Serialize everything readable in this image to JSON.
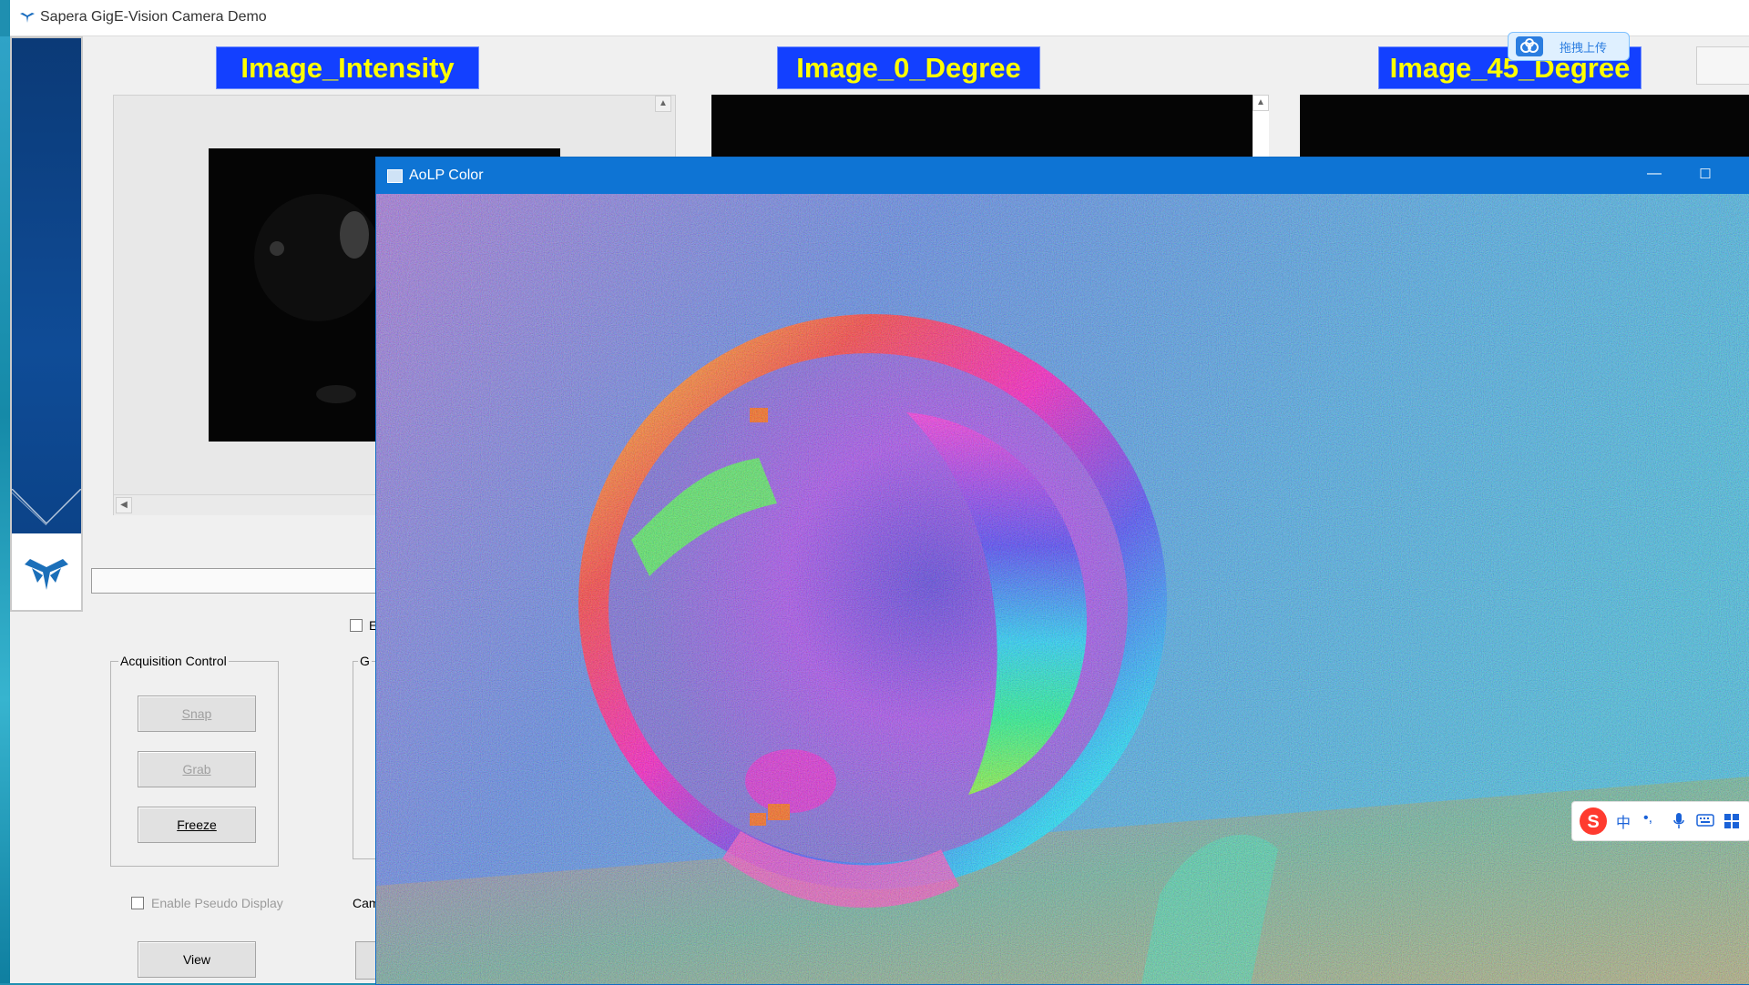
{
  "app": {
    "title": "Sapera GigE-Vision Camera Demo"
  },
  "image_labels": [
    "Image_Intensity",
    "Image_0_Degree",
    "Image_45_Degree"
  ],
  "acquisition": {
    "title": "Acquisition Control",
    "snap_label": "Snap",
    "grab_label": "Grab",
    "freeze_label": "Freeze"
  },
  "pseudo_display": {
    "label": "Enable Pseudo Display",
    "checked": false
  },
  "view_label": "View",
  "partial": {
    "group_partial": "G",
    "cam_partial": "Cam",
    "e_partial": "E"
  },
  "aolp_window": {
    "title": "AoLP Color",
    "minimize_glyph": "—",
    "maximize_glyph": "☐"
  },
  "upload_widget": {
    "label": "拖拽上传"
  },
  "ime_toolbar": {
    "mode_label": "中",
    "punct_label": "•,"
  },
  "colors": {
    "label_bg": "#1340ff",
    "label_fg": "#ffff00",
    "titlebar_blue": "#0e74d4",
    "logo_blue": "#0f4c97"
  },
  "icons": [
    "teledyne-logo-icon",
    "window-icon",
    "minimize-icon",
    "maximize-icon",
    "cloud-upload-icon",
    "sogou-icon",
    "mic-icon",
    "keyboard-icon",
    "grid-icon"
  ]
}
